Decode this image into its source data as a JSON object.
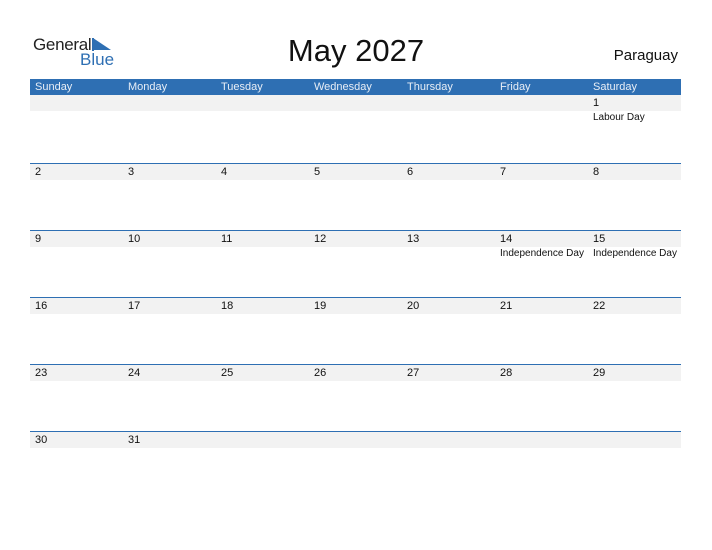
{
  "logo": {
    "word1": "General",
    "word2": "Blue"
  },
  "title": "May 2027",
  "country": "Paraguay",
  "colors": {
    "accent": "#2e6fb3",
    "band": "#f2f2f2"
  },
  "days_of_week": [
    "Sunday",
    "Monday",
    "Tuesday",
    "Wednesday",
    "Thursday",
    "Friday",
    "Saturday"
  ],
  "weeks": [
    [
      {
        "day": ""
      },
      {
        "day": ""
      },
      {
        "day": ""
      },
      {
        "day": ""
      },
      {
        "day": ""
      },
      {
        "day": ""
      },
      {
        "day": "1",
        "holiday": "Labour Day"
      }
    ],
    [
      {
        "day": "2"
      },
      {
        "day": "3"
      },
      {
        "day": "4"
      },
      {
        "day": "5"
      },
      {
        "day": "6"
      },
      {
        "day": "7"
      },
      {
        "day": "8"
      }
    ],
    [
      {
        "day": "9"
      },
      {
        "day": "10"
      },
      {
        "day": "11"
      },
      {
        "day": "12"
      },
      {
        "day": "13"
      },
      {
        "day": "14",
        "holiday": "Independence Day"
      },
      {
        "day": "15",
        "holiday": "Independence Day"
      }
    ],
    [
      {
        "day": "16"
      },
      {
        "day": "17"
      },
      {
        "day": "18"
      },
      {
        "day": "19"
      },
      {
        "day": "20"
      },
      {
        "day": "21"
      },
      {
        "day": "22"
      }
    ],
    [
      {
        "day": "23"
      },
      {
        "day": "24"
      },
      {
        "day": "25"
      },
      {
        "day": "26"
      },
      {
        "day": "27"
      },
      {
        "day": "28"
      },
      {
        "day": "29"
      }
    ],
    [
      {
        "day": "30"
      },
      {
        "day": "31"
      },
      {
        "day": ""
      },
      {
        "day": ""
      },
      {
        "day": ""
      },
      {
        "day": ""
      },
      {
        "day": ""
      }
    ]
  ]
}
